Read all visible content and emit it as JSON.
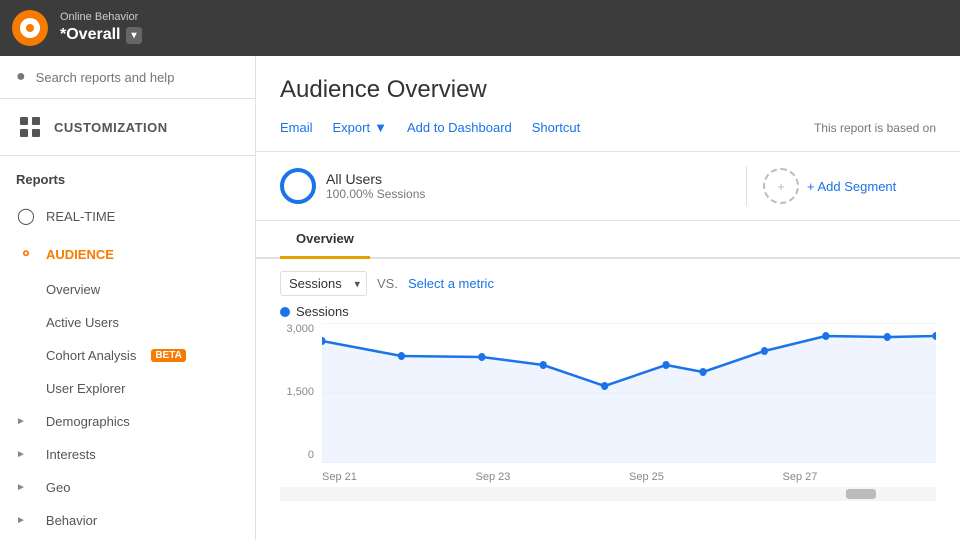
{
  "topbar": {
    "account_type": "Online Behavior",
    "account_name": "*Overall",
    "dropdown_label": "▾"
  },
  "sidebar": {
    "search_placeholder": "Search reports and help",
    "customization_label": "CUSTOMIZATION",
    "reports_label": "Reports",
    "nav_items": [
      {
        "id": "realtime",
        "label": "REAL-TIME",
        "icon": "clock"
      },
      {
        "id": "audience",
        "label": "AUDIENCE",
        "icon": "person",
        "active": true
      }
    ],
    "audience_subnav": [
      {
        "id": "overview",
        "label": "Overview",
        "indent": true
      },
      {
        "id": "active-users",
        "label": "Active Users",
        "indent": true
      },
      {
        "id": "cohort",
        "label": "Cohort Analysis",
        "indent": true,
        "beta": true
      },
      {
        "id": "user-explorer",
        "label": "User Explorer",
        "indent": true
      },
      {
        "id": "demographics",
        "label": "Demographics",
        "indent": true,
        "arrow": true
      },
      {
        "id": "interests",
        "label": "Interests",
        "indent": true,
        "arrow": true
      },
      {
        "id": "geo",
        "label": "Geo",
        "indent": true,
        "arrow": true
      },
      {
        "id": "behavior",
        "label": "Behavior",
        "indent": true,
        "arrow": true
      }
    ]
  },
  "content": {
    "page_title": "Audience Overview",
    "toolbar": {
      "email_label": "Email",
      "export_label": "Export",
      "add_dashboard_label": "Add to Dashboard",
      "shortcut_label": "Shortcut",
      "report_note": "This report is based on"
    },
    "segment": {
      "name": "All Users",
      "detail": "100.00% Sessions",
      "add_label": "+ Add Segment"
    },
    "tab_overview": "Overview",
    "chart": {
      "metric_default": "Sessions",
      "vs_label": "VS.",
      "select_metric_label": "Select a metric",
      "sessions_label": "Sessions",
      "y_labels": [
        "3,000",
        "1,500",
        "0"
      ],
      "x_labels": [
        "Sep 21",
        "Sep 23",
        "Sep 25",
        "Sep 27",
        ""
      ],
      "data_points": [
        {
          "x": 0,
          "y": 0.87
        },
        {
          "x": 0.13,
          "y": 0.78
        },
        {
          "x": 0.26,
          "y": 0.76
        },
        {
          "x": 0.36,
          "y": 0.7
        },
        {
          "x": 0.46,
          "y": 0.5
        },
        {
          "x": 0.56,
          "y": 0.7
        },
        {
          "x": 0.62,
          "y": 0.65
        },
        {
          "x": 0.72,
          "y": 0.8
        },
        {
          "x": 0.82,
          "y": 0.91
        },
        {
          "x": 0.92,
          "y": 0.9
        },
        {
          "x": 1.0,
          "y": 0.91
        }
      ]
    }
  }
}
